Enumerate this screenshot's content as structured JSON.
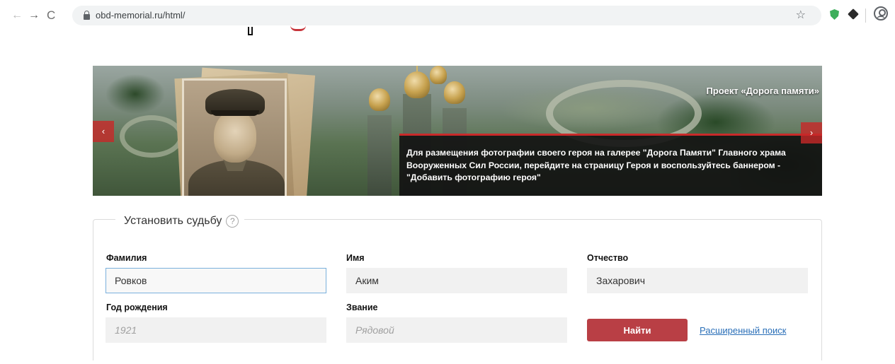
{
  "browser": {
    "url": "obd-memorial.ru/html/",
    "back_icon": "←",
    "forward_icon": "→",
    "reload_icon": "C",
    "star_icon": "☆"
  },
  "banner": {
    "title": "Проект «Дорога памяти»",
    "caption": "Для размещения фотографии своего героя на галерее \"Дорога Памяти\" Главного храма Вооруженных Сил России, перейдите на страницу Героя и воспользуйтесь баннером - \"Добавить фотографию героя\"",
    "prev_icon": "‹",
    "next_icon": "›"
  },
  "form": {
    "legend": "Установить судьбу",
    "help_icon": "?",
    "fields": {
      "surname": {
        "label": "Фамилия",
        "value": "Ровков"
      },
      "name": {
        "label": "Имя",
        "value": "Аким"
      },
      "patronymic": {
        "label": "Отчество",
        "value": "Захарович"
      },
      "birth_year": {
        "label": "Год рождения",
        "placeholder": "1921"
      },
      "rank": {
        "label": "Звание",
        "placeholder": "Рядовой"
      }
    },
    "submit_label": "Найти",
    "advanced_link": "Расширенный поиск"
  },
  "colors": {
    "accent_red": "#b93f45",
    "link_blue": "#2a6fb8",
    "active_border": "#7ab0dc"
  }
}
